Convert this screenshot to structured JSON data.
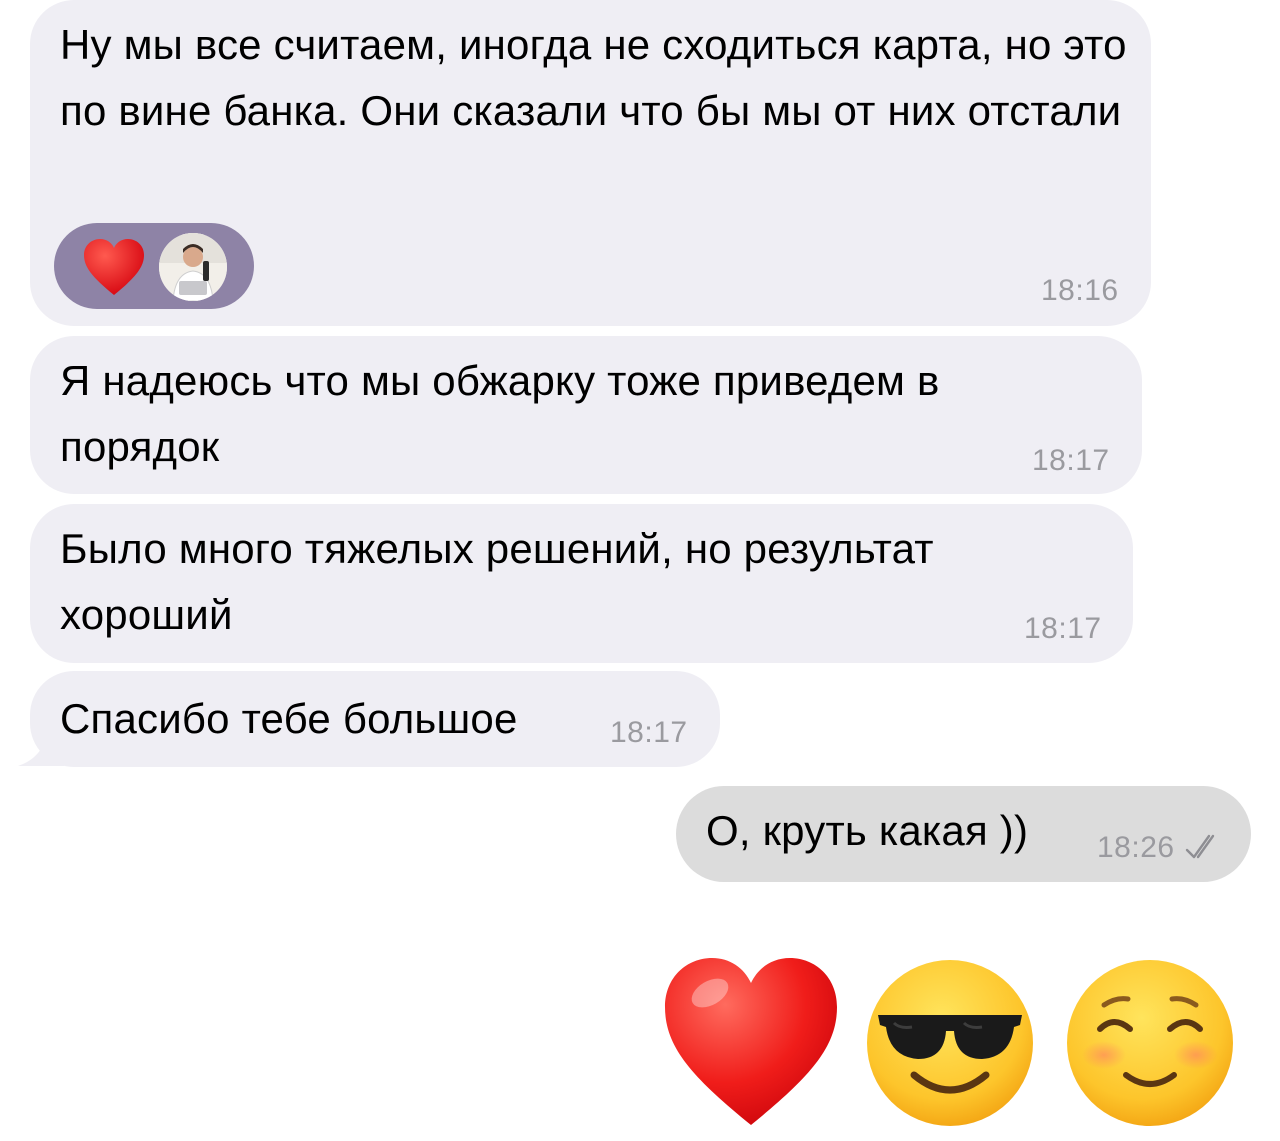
{
  "messages": [
    {
      "text": "Ну мы все считаем, иногда не сходиться карта, но это по вине банка. Они сказали что бы мы от них отстали",
      "time": "18:16",
      "reactions": [
        "heart",
        "avatar"
      ]
    },
    {
      "text": "Я надеюсь что мы обжарку тоже приведем в порядок",
      "time": "18:17"
    },
    {
      "text": "Было много тяжелых решений, но результат хороший",
      "time": "18:17"
    },
    {
      "text": "Спасибо тебе большое",
      "time": "18:17"
    },
    {
      "text": "О, круть какая ))",
      "time": "18:26",
      "status": "read"
    }
  ],
  "emoji_message": {
    "items": [
      "red-heart",
      "smiling-face-with-sunglasses",
      "smiling-face"
    ]
  },
  "colors": {
    "incoming_bubble": "#efeef4",
    "outgoing_bubble": "#dcdcdc",
    "reaction_pill": "#8e83a6",
    "time_text": "#9a9a9f"
  }
}
